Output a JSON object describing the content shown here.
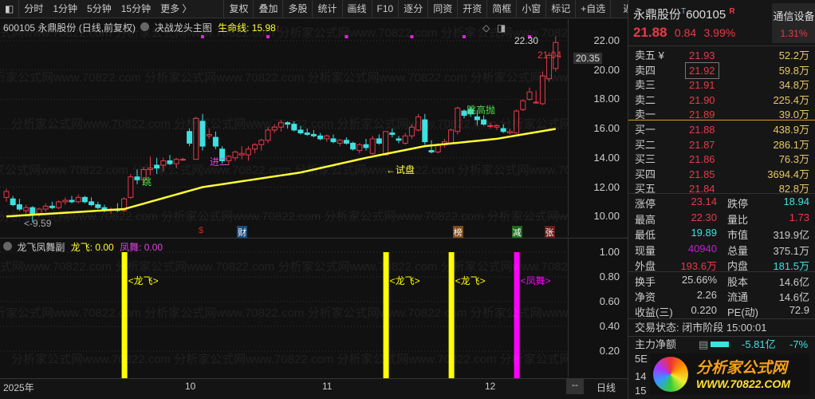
{
  "toolbar": {
    "items": [
      "分时",
      "1分钟",
      "5分钟",
      "15分钟",
      "更多 〉"
    ],
    "buttons": [
      "复权",
      "叠加",
      "多股",
      "统计",
      "画线",
      "F10",
      "逐分",
      "同资",
      "开资",
      "简框",
      "小窗",
      "标记",
      "+自选",
      "返回"
    ]
  },
  "header": {
    "code_name": "600105 永鼎股份 (日线,前复权)",
    "indicator": "决战龙头主图",
    "life_line_label": "生命线: 15.98",
    "up_arrow": "↑"
  },
  "watermark": "分析家公式网www.70822.com ",
  "price_axis": [
    "22.00",
    "20.00",
    "18.00",
    "16.00",
    "14.00",
    "12.00",
    "10.00"
  ],
  "price_axis_values": [
    22,
    20,
    18,
    16,
    14,
    12,
    10
  ],
  "current_price_tag": "20.35",
  "annotations": {
    "high": "22.30",
    "close_mark": "21.04",
    "low": "9.59",
    "jin2": "进二",
    "tiao": "跳",
    "tiao_gao_pao": "跳高抛",
    "shi_pan": "←试盘"
  },
  "event_markers": [
    {
      "label": "$",
      "color": "#e02020",
      "bg": "transparent",
      "idx": 30
    },
    {
      "label": "财",
      "color": "#ffffff",
      "bg": "#1a4a7a",
      "idx": 36
    },
    {
      "label": "榜",
      "color": "#ffffff",
      "bg": "#7a4a1a",
      "idx": 69
    },
    {
      "label": "减",
      "color": "#ffffff",
      "bg": "#1a6a1a",
      "idx": 78
    },
    {
      "label": "张",
      "color": "#ffffff",
      "bg": "#6a1a1a",
      "idx": 83
    }
  ],
  "chart_data": {
    "type": "candlestick",
    "candles": [
      [
        11.3,
        11.9,
        11.0,
        11.7
      ],
      [
        11.2,
        11.4,
        10.7,
        10.8
      ],
      [
        10.8,
        11.2,
        10.4,
        10.5
      ],
      [
        10.4,
        10.8,
        10.2,
        10.6
      ],
      [
        10.6,
        10.7,
        9.59,
        10.1
      ],
      [
        10.2,
        10.6,
        10.0,
        10.5
      ],
      [
        10.5,
        10.9,
        10.3,
        10.7
      ],
      [
        10.7,
        11.0,
        10.5,
        10.6
      ],
      [
        10.6,
        11.1,
        10.5,
        11.0
      ],
      [
        11.0,
        11.3,
        10.8,
        11.1
      ],
      [
        11.1,
        11.4,
        10.9,
        11.0
      ],
      [
        11.0,
        11.5,
        10.9,
        11.3
      ],
      [
        11.3,
        11.4,
        10.9,
        11.0
      ],
      [
        11.0,
        11.3,
        10.7,
        10.8
      ],
      [
        10.8,
        11.0,
        10.5,
        10.6
      ],
      [
        10.6,
        10.8,
        10.3,
        10.4
      ],
      [
        10.4,
        10.6,
        10.2,
        10.5
      ],
      [
        10.5,
        10.9,
        10.3,
        10.4
      ],
      [
        10.4,
        11.3,
        10.3,
        11.2
      ],
      [
        11.3,
        12.9,
        11.2,
        12.7
      ],
      [
        12.7,
        13.2,
        12.2,
        12.5
      ],
      [
        12.5,
        13.4,
        12.3,
        13.2
      ],
      [
        13.2,
        14.1,
        12.8,
        13.3
      ],
      [
        13.5,
        14.0,
        12.9,
        13.3
      ],
      [
        13.5,
        14.0,
        13.1,
        13.8
      ],
      [
        13.8,
        14.2,
        13.5,
        13.6
      ],
      [
        13.6,
        14.0,
        13.3,
        13.9
      ],
      [
        13.9,
        14.0,
        13.8,
        13.9
      ],
      [
        15.8,
        16.0,
        14.8,
        15.0
      ],
      [
        13.9,
        16.8,
        13.9,
        16.7
      ],
      [
        16.5,
        17.0,
        14.5,
        14.8
      ],
      [
        15.5,
        16.0,
        15.3,
        15.6
      ],
      [
        15.4,
        15.8,
        14.6,
        14.8
      ],
      [
        14.6,
        14.8,
        13.6,
        13.8
      ],
      [
        13.8,
        14.2,
        13.5,
        14.1
      ],
      [
        14.0,
        14.5,
        13.8,
        14.4
      ],
      [
        14.2,
        14.8,
        13.9,
        14.3
      ],
      [
        14.2,
        14.8,
        13.8,
        14.6
      ],
      [
        14.6,
        15.0,
        14.3,
        14.9
      ],
      [
        14.9,
        15.3,
        14.5,
        15.2
      ],
      [
        15.2,
        16.1,
        15.0,
        15.9
      ],
      [
        15.9,
        16.3,
        15.7,
        16.1
      ],
      [
        16.1,
        16.6,
        15.8,
        16.4
      ],
      [
        16.4,
        16.5,
        16.0,
        16.3
      ],
      [
        16.3,
        16.5,
        15.8,
        15.9
      ],
      [
        15.9,
        16.2,
        15.6,
        15.7
      ],
      [
        15.7,
        16.0,
        15.5,
        15.6
      ],
      [
        15.6,
        15.9,
        15.4,
        15.5
      ],
      [
        15.5,
        15.7,
        15.2,
        15.3
      ],
      [
        15.3,
        15.6,
        15.1,
        15.5
      ],
      [
        15.3,
        15.6,
        15.0,
        15.1
      ],
      [
        15.0,
        15.3,
        14.8,
        15.2
      ],
      [
        15.2,
        15.4,
        14.9,
        15.0
      ],
      [
        15.0,
        15.1,
        14.5,
        14.6
      ],
      [
        14.5,
        15.0,
        14.3,
        14.9
      ],
      [
        14.9,
        15.3,
        14.5,
        14.7
      ],
      [
        14.3,
        15.5,
        14.2,
        15.3
      ],
      [
        15.3,
        15.6,
        14.9,
        15.0
      ],
      [
        14.2,
        15.8,
        14.2,
        15.8
      ],
      [
        15.7,
        16.0,
        15.4,
        15.6
      ],
      [
        15.3,
        15.5,
        15.0,
        15.2
      ],
      [
        15.0,
        15.7,
        14.9,
        15.5
      ],
      [
        15.5,
        16.3,
        15.3,
        16.1
      ],
      [
        15.9,
        17.0,
        15.8,
        16.8
      ],
      [
        16.6,
        17.0,
        14.9,
        15.1
      ],
      [
        14.5,
        15.2,
        14.3,
        14.4
      ],
      [
        14.4,
        15.0,
        14.3,
        14.9
      ],
      [
        14.9,
        15.3,
        14.7,
        15.1
      ],
      [
        15.0,
        16.0,
        14.9,
        15.9
      ],
      [
        15.8,
        17.5,
        15.6,
        17.4
      ],
      [
        17.2,
        17.3,
        16.7,
        16.9
      ],
      [
        17.3,
        17.5,
        16.8,
        17.0
      ],
      [
        16.8,
        17.2,
        16.2,
        16.6
      ],
      [
        16.6,
        16.9,
        16.2,
        16.3
      ],
      [
        16.2,
        16.4,
        16.0,
        16.2
      ],
      [
        16.1,
        16.3,
        15.9,
        16.2
      ],
      [
        16.0,
        16.3,
        15.7,
        15.8
      ],
      [
        15.7,
        16.0,
        15.6,
        15.8
      ],
      [
        15.7,
        17.3,
        15.7,
        17.2
      ],
      [
        17.3,
        18.0,
        17.2,
        17.9
      ],
      [
        18.0,
        18.8,
        17.9,
        18.5
      ],
      [
        17.8,
        18.6,
        17.7,
        17.8
      ],
      [
        17.7,
        19.9,
        17.6,
        19.6
      ],
      [
        19.4,
        21.2,
        19.2,
        21.0
      ],
      [
        20.1,
        22.3,
        19.89,
        21.88
      ]
    ],
    "ma_keypoints": [
      [
        0,
        10.0
      ],
      [
        18,
        10.5
      ],
      [
        30,
        12.0
      ],
      [
        45,
        13.0
      ],
      [
        55,
        14.0
      ],
      [
        64,
        14.8
      ],
      [
        75,
        15.3
      ],
      [
        84,
        15.98
      ]
    ],
    "ma_name": "生命线",
    "ylim": [
      9.5,
      22.5
    ]
  },
  "sub": {
    "title": "龙飞凤舞副",
    "long_fei_label": "龙飞: 0.00",
    "feng_wu_label": "凤舞: 0.00",
    "axis": [
      "1.00",
      "0.80",
      "0.60",
      "0.40",
      "0.20"
    ],
    "axis_values": [
      1,
      0.8,
      0.6,
      0.4,
      0.2
    ],
    "bars": [
      {
        "idx": 18,
        "value": 1,
        "color": "#ffff00",
        "label": "<龙飞>"
      },
      {
        "idx": 58,
        "value": 1,
        "color": "#ffff00",
        "label": "<龙飞>"
      },
      {
        "idx": 68,
        "value": 1,
        "color": "#ffff00",
        "label": "<龙飞>"
      },
      {
        "idx": 78,
        "value": 1,
        "color": "#ff00ff",
        "label": "<凤舞>"
      }
    ]
  },
  "timeaxis": {
    "labels": [
      "2025年",
      "10",
      "11",
      "12"
    ],
    "dash": "--",
    "period": "日线"
  },
  "quote": {
    "name": "永鼎股份",
    "t": "T",
    "code": "600105",
    "r": "R",
    "sector": "通信设备",
    "sector_pct": "1.31%",
    "price": "21.88",
    "change": "0.84",
    "pct": "3.99%",
    "asks": [
      [
        "卖五 ¥",
        "21.93",
        "52.2万"
      ],
      [
        "卖四",
        "21.92",
        "59.8万"
      ],
      [
        "卖三",
        "21.91",
        "34.8万"
      ],
      [
        "卖二",
        "21.90",
        "225.4万"
      ],
      [
        "卖一",
        "21.89",
        "39.0万"
      ]
    ],
    "bids": [
      [
        "买一",
        "21.88",
        "438.9万"
      ],
      [
        "买二",
        "21.87",
        "286.1万"
      ],
      [
        "买三",
        "21.86",
        "76.3万"
      ],
      [
        "买四",
        "21.85",
        "3694.4万"
      ],
      [
        "买五",
        "21.84",
        "82.8万"
      ]
    ],
    "stats1": [
      [
        "涨停",
        "23.14",
        "red",
        "跌停",
        "18.94",
        "cyan"
      ],
      [
        "最高",
        "22.30",
        "red",
        "量比",
        "1.73",
        "red"
      ],
      [
        "最低",
        "19.89",
        "cyan",
        "市值",
        "319.9亿",
        "wht"
      ],
      [
        "现量",
        "40940",
        "mag",
        "总量",
        "375.1万",
        "wht"
      ],
      [
        "外盘",
        "193.6万",
        "red",
        "内盘",
        "181.5万",
        "cyan"
      ]
    ],
    "stats2": [
      [
        "换手",
        "25.66%",
        "股本",
        "14.6亿"
      ],
      [
        "净资",
        "2.26",
        "流通",
        "14.6亿"
      ],
      [
        "收益(三)",
        "0.220",
        "PE(动)",
        "72.9"
      ]
    ],
    "status": "交易状态: 闭市阶段 15:00:01",
    "main_net_label": "主力净额",
    "main_net": "-5.81亿",
    "main_net_pct": "-7%",
    "partial": [
      "5E",
      "14",
      "15"
    ],
    "logo_text": "分析家公式网",
    "logo_url": "WWW.70822.COM"
  }
}
